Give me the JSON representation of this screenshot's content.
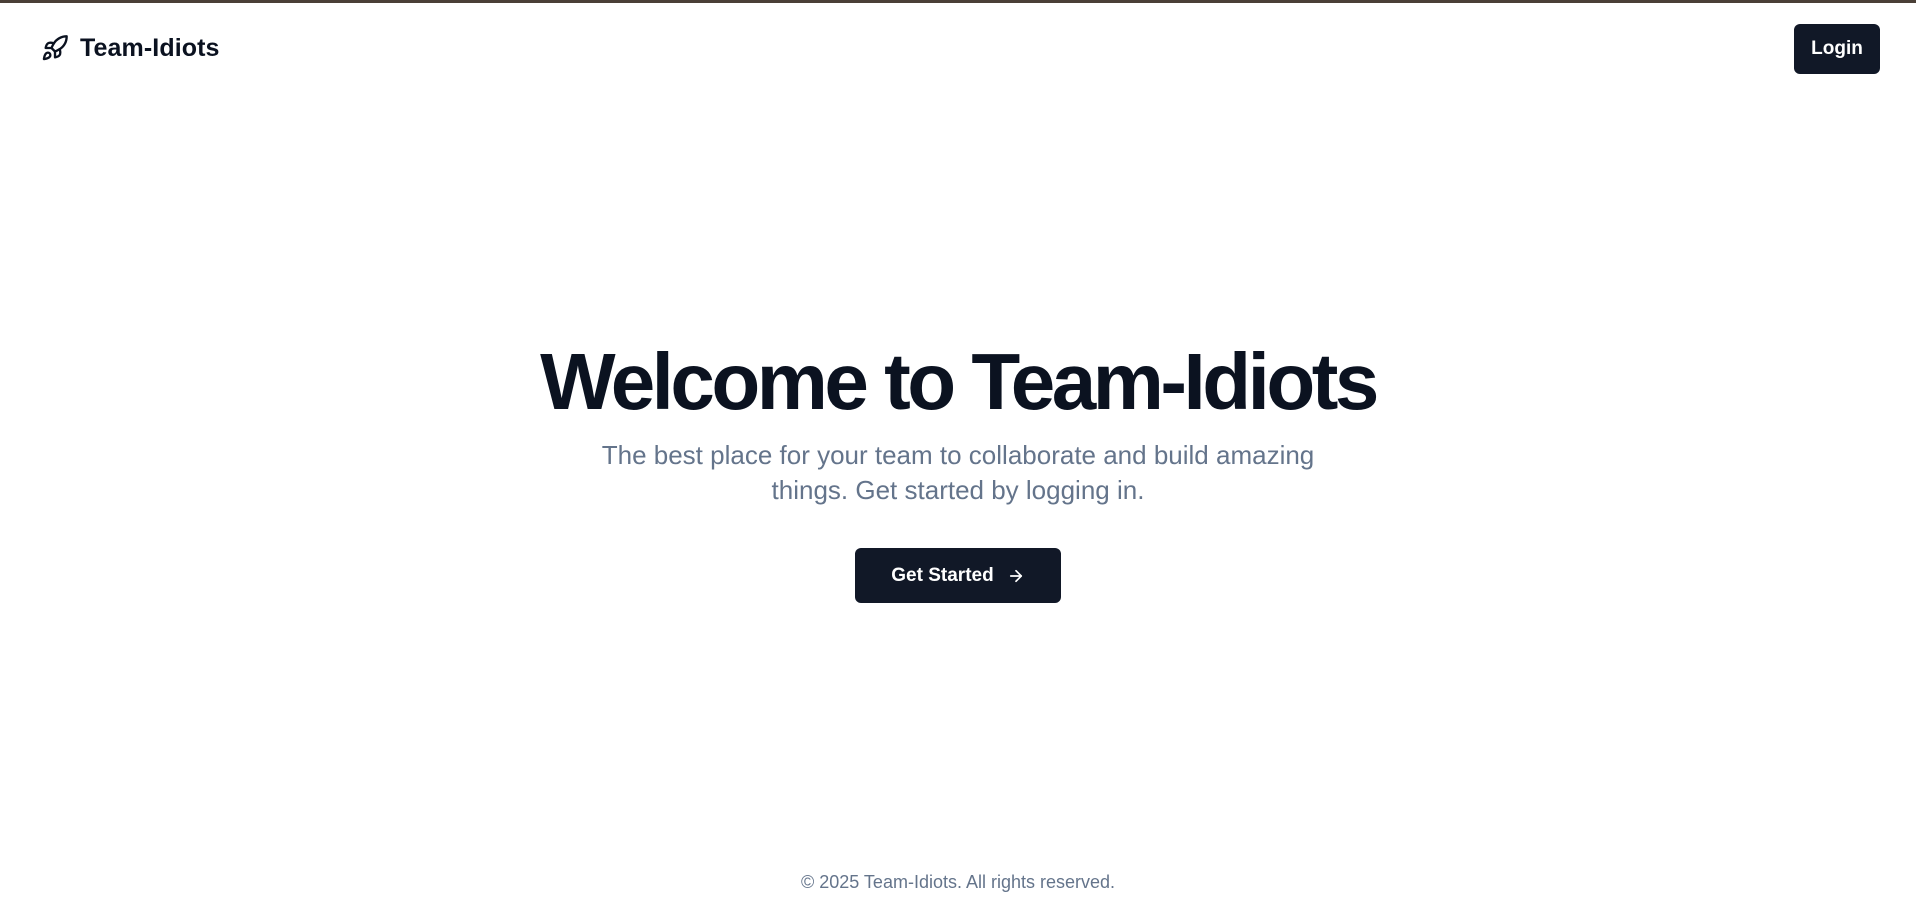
{
  "colors": {
    "top_border": "#4a3f37",
    "primary_button": "#111827",
    "heading_text": "#0b1220",
    "muted_text": "#64748b"
  },
  "header": {
    "brand_icon": "rocket-icon",
    "brand_name": "Team-Idiots",
    "login_label": "Login"
  },
  "hero": {
    "title": "Welcome to Team-Idiots",
    "subtitle": "The best place for your team to collaborate and build amazing things. Get started by logging in.",
    "cta_label": "Get Started",
    "cta_icon": "arrow-right-icon"
  },
  "footer": {
    "copyright": "© 2025 Team-Idiots. All rights reserved."
  }
}
